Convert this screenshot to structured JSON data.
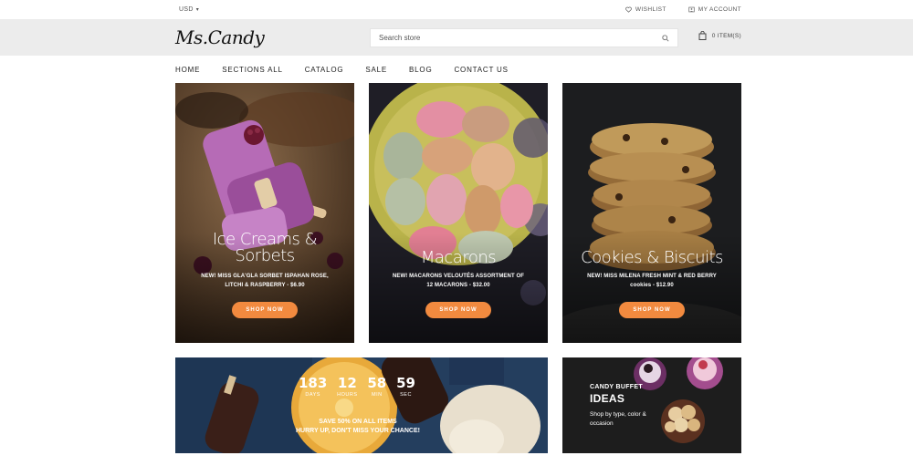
{
  "topbar": {
    "currency": "USD",
    "wishlist": "WISHLIST",
    "account": "MY ACCOUNT"
  },
  "header": {
    "logo": "Ms.Candy",
    "search_placeholder": "Search store",
    "cart": "0 ITEM(S)"
  },
  "nav": {
    "items": [
      "HOME",
      "SECTIONS ALL",
      "CATALOG",
      "SALE",
      "BLOG",
      "CONTACT US"
    ]
  },
  "tiles": [
    {
      "title_line1": "Ice Creams &",
      "title_line2": "Sorbets",
      "desc_line1": "NEW! MISS GLA'GLA SORBET ISPAHAN ROSE,",
      "desc_line2": "LITCHI & RASPBERRY - $6.90",
      "button": "SHOP NOW"
    },
    {
      "title_line1": "Macarons",
      "desc_line1": "NEW! MACARONS VELOUTÉS ASSORTMENT OF",
      "desc_line2": "12 MACARONS - $32.00",
      "button": "SHOP NOW"
    },
    {
      "title_line1": "Cookies & Biscuits",
      "desc_line1": "NEW! MISS MILENA FRESH MINT & RED BERRY",
      "desc_line2": "cookies - $12.90",
      "button": "SHOP NOW"
    }
  ],
  "sale_banner": {
    "countdown": [
      {
        "value": "183",
        "label": "DAYS"
      },
      {
        "value": "12",
        "label": "HOURS"
      },
      {
        "value": "58",
        "label": "MIN"
      },
      {
        "value": "59",
        "label": "SEC"
      }
    ],
    "line1": "SAVE 50% ON ALL ITEMS",
    "line2": "HURRY UP, DON'T MISS YOUR CHANCE!"
  },
  "candy_banner": {
    "line1": "CANDY BUFFET",
    "line2": "IDEAS",
    "sub": "Shop by type, color & occasion"
  },
  "colors": {
    "accent": "#f28a3f",
    "header_bg": "#ececec"
  }
}
